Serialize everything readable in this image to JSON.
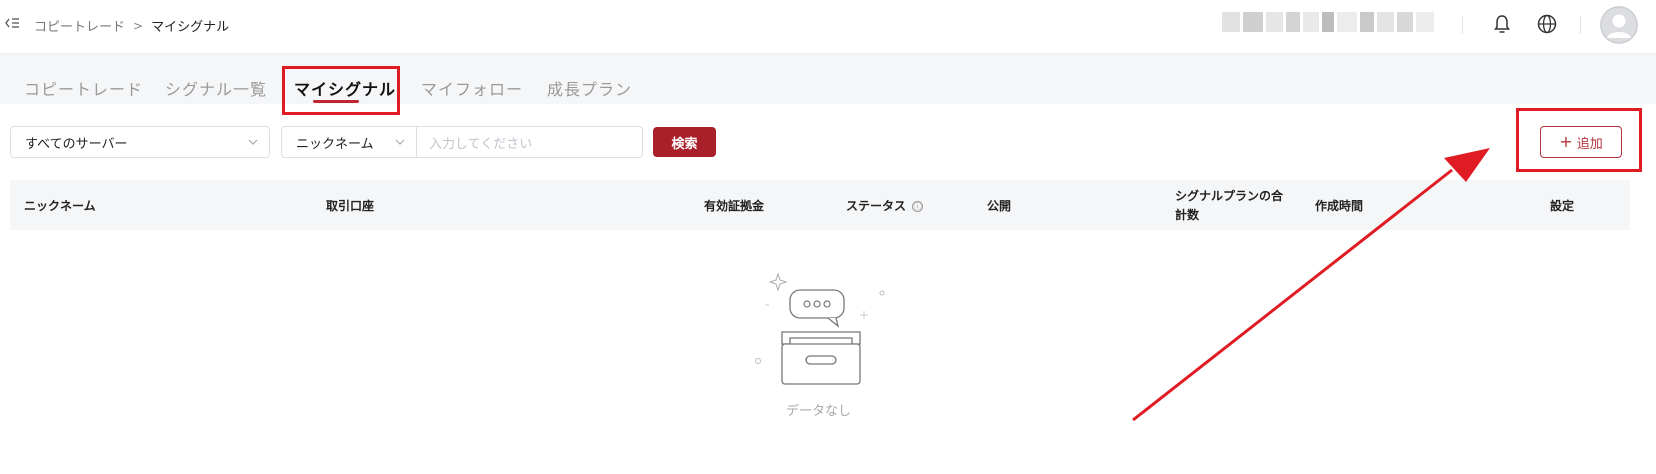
{
  "breadcrumb": {
    "parent": "コピートレード",
    "separator": ">",
    "current": "マイシグナル"
  },
  "header": {
    "icons": [
      "bell-icon",
      "globe-icon"
    ],
    "avatar": "avatar-icon"
  },
  "tabs": [
    {
      "label": "コピートレード",
      "active": false
    },
    {
      "label": "シグナル一覧",
      "active": false
    },
    {
      "label": "マイシグナル",
      "active": true
    },
    {
      "label": "マイフォロー",
      "active": false
    },
    {
      "label": "成長プラン",
      "active": false
    }
  ],
  "filters": {
    "server_select": "すべてのサーバー",
    "field_select": "ニックネーム",
    "search_placeholder": "入力してください",
    "search_button": "検索"
  },
  "add_button": {
    "icon": "+",
    "label": "追加"
  },
  "table": {
    "columns": [
      "ニックネーム",
      "取引口座",
      "有効証拠金",
      "ステータス",
      "公開",
      "シグナルプランの合計数",
      "作成時間",
      "設定"
    ],
    "status_info_icon": "ⓘ",
    "rows": []
  },
  "empty_state": {
    "text": "データなし"
  },
  "colors": {
    "brand": "#a9202a",
    "highlight": "#e01b24",
    "tabs_background": "#f5f6f8"
  }
}
